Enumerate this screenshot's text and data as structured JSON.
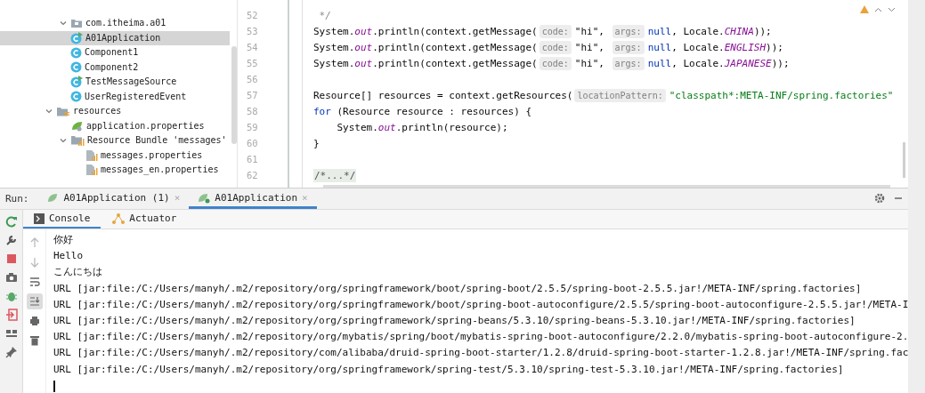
{
  "project_tree": [
    {
      "label": "com.itheima.a01",
      "kind": "package",
      "expanded": true,
      "selected": false,
      "children": [
        {
          "label": "A01Application",
          "kind": "app-class",
          "selected": true
        },
        {
          "label": "Component1",
          "kind": "class",
          "selected": false
        },
        {
          "label": "Component2",
          "kind": "class",
          "selected": false
        },
        {
          "label": "TestMessageSource",
          "kind": "app-class",
          "selected": false
        },
        {
          "label": "UserRegisteredEvent",
          "kind": "class",
          "selected": false
        }
      ]
    },
    {
      "label": "resources",
      "kind": "resources",
      "expanded": true,
      "selected": false,
      "children": [
        {
          "label": "application.properties",
          "kind": "spring-properties",
          "selected": false
        },
        {
          "label": "Resource Bundle 'messages'",
          "kind": "bundle",
          "expanded": true,
          "selected": false,
          "children": [
            {
              "label": "messages.properties",
              "kind": "properties",
              "selected": false
            },
            {
              "label": "messages_en.properties",
              "kind": "properties",
              "selected": false
            }
          ]
        }
      ]
    }
  ],
  "editor": {
    "lines": [
      {
        "number": "52",
        "tokens": [
          {
            "kind": "comment",
            "text": " */"
          }
        ]
      },
      {
        "number": "53",
        "tokens": [
          {
            "kind": "plain",
            "text": "System."
          },
          {
            "kind": "field",
            "text": "out"
          },
          {
            "kind": "plain",
            "text": ".println(context.getMessage("
          },
          {
            "kind": "hint",
            "text": "code:"
          },
          {
            "kind": "plain",
            "text": "\"hi\", "
          },
          {
            "kind": "hint",
            "text": "args:"
          },
          {
            "kind": "keyword",
            "text": "null"
          },
          {
            "kind": "plain",
            "text": ", Locale."
          },
          {
            "kind": "field",
            "text": "CHINA"
          },
          {
            "kind": "plain",
            "text": "));"
          }
        ]
      },
      {
        "number": "54",
        "tokens": [
          {
            "kind": "plain",
            "text": "System."
          },
          {
            "kind": "field",
            "text": "out"
          },
          {
            "kind": "plain",
            "text": ".println(context.getMessage("
          },
          {
            "kind": "hint",
            "text": "code:"
          },
          {
            "kind": "plain",
            "text": "\"hi\", "
          },
          {
            "kind": "hint",
            "text": "args:"
          },
          {
            "kind": "keyword",
            "text": "null"
          },
          {
            "kind": "plain",
            "text": ", Locale."
          },
          {
            "kind": "field",
            "text": "ENGLISH"
          },
          {
            "kind": "plain",
            "text": "));"
          }
        ]
      },
      {
        "number": "55",
        "tokens": [
          {
            "kind": "plain",
            "text": "System."
          },
          {
            "kind": "field",
            "text": "out"
          },
          {
            "kind": "plain",
            "text": ".println(context.getMessage("
          },
          {
            "kind": "hint",
            "text": "code:"
          },
          {
            "kind": "plain",
            "text": "\"hi\", "
          },
          {
            "kind": "hint",
            "text": "args:"
          },
          {
            "kind": "keyword",
            "text": "null"
          },
          {
            "kind": "plain",
            "text": ", Locale."
          },
          {
            "kind": "field",
            "text": "JAPANESE"
          },
          {
            "kind": "plain",
            "text": "));"
          }
        ]
      },
      {
        "number": "56"
      },
      {
        "number": "57",
        "tokens": [
          {
            "kind": "plain",
            "text": "Resource[] resources = context.getResources("
          },
          {
            "kind": "hint",
            "text": "locationPattern:"
          },
          {
            "kind": "string",
            "text": "\"classpath*:META-INF/spring.factories\""
          }
        ]
      },
      {
        "number": "58",
        "tokens": [
          {
            "kind": "keyword",
            "text": "for"
          },
          {
            "kind": "plain",
            "text": " (Resource resource : resources) {"
          }
        ]
      },
      {
        "number": "59",
        "tokens": [
          {
            "kind": "plain",
            "text": "    System."
          },
          {
            "kind": "field",
            "text": "out"
          },
          {
            "kind": "plain",
            "text": ".println(resource);"
          }
        ]
      },
      {
        "number": "60",
        "tokens": [
          {
            "kind": "plain",
            "text": "}"
          }
        ]
      },
      {
        "number": "61"
      },
      {
        "number": "62",
        "tokens": [
          {
            "kind": "folded",
            "text": "/*...*/"
          }
        ]
      }
    ]
  },
  "run_panel": {
    "label": "Run:",
    "tabs": [
      {
        "label": "A01Application (1)",
        "close": "×",
        "selected": false
      },
      {
        "label": "A01Application",
        "close": "×",
        "selected": true
      }
    ],
    "tool_tabs": [
      {
        "label": "Console",
        "kind": "console",
        "selected": true
      },
      {
        "label": "Actuator",
        "kind": "actuator",
        "selected": false
      }
    ],
    "soft_wrap": false,
    "scroll_to_end": true,
    "console_lines": [
      "你好",
      "Hello",
      "こんにちは",
      "URL [jar:file:/C:/Users/manyh/.m2/repository/org/springframework/boot/spring-boot/2.5.5/spring-boot-2.5.5.jar!/META-INF/spring.factories]",
      "URL [jar:file:/C:/Users/manyh/.m2/repository/org/springframework/boot/spring-boot-autoconfigure/2.5.5/spring-boot-autoconfigure-2.5.5.jar!/META-I",
      "URL [jar:file:/C:/Users/manyh/.m2/repository/org/springframework/spring-beans/5.3.10/spring-beans-5.3.10.jar!/META-INF/spring.factories]",
      "URL [jar:file:/C:/Users/manyh/.m2/repository/org/mybatis/spring/boot/mybatis-spring-boot-autoconfigure/2.2.0/mybatis-spring-boot-autoconfigure-2.",
      "URL [jar:file:/C:/Users/manyh/.m2/repository/com/alibaba/druid-spring-boot-starter/1.2.8/druid-spring-boot-starter-1.2.8.jar!/META-INF/spring.fac",
      "URL [jar:file:/C:/Users/manyh/.m2/repository/org/springframework/spring-test/5.3.10/spring-test-5.3.10.jar!/META-INF/spring.factories]"
    ]
  }
}
